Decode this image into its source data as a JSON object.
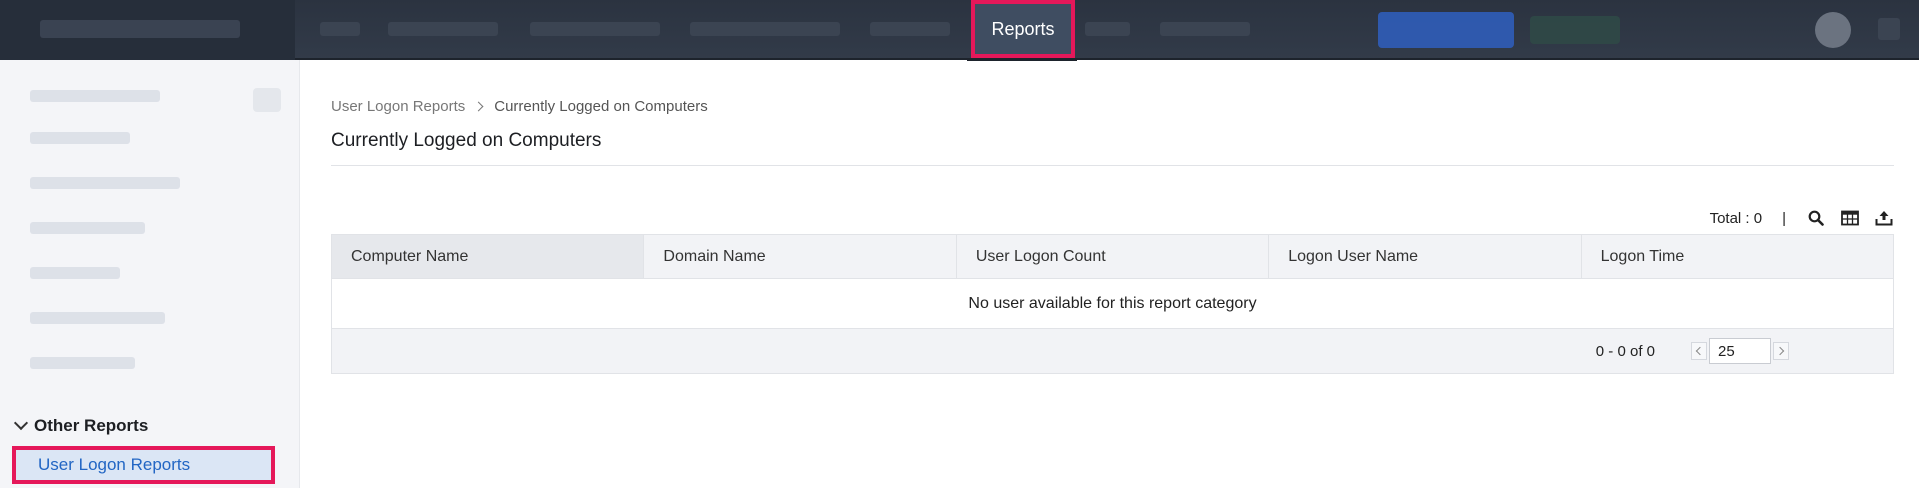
{
  "header": {
    "active_tab": "Reports"
  },
  "sidebar": {
    "section": {
      "label": "Other Reports"
    },
    "selected_item": {
      "label": "User Logon Reports"
    }
  },
  "breadcrumb": {
    "parent": "User Logon Reports",
    "current": "Currently Logged on Computers"
  },
  "page": {
    "title": "Currently Logged on Computers"
  },
  "toolbar": {
    "total_label": "Total : 0",
    "separator": "|",
    "icons": [
      "search-icon",
      "table-columns-icon",
      "export-icon"
    ]
  },
  "table": {
    "columns": [
      "Computer Name",
      "Domain Name",
      "User Logon Count",
      "Logon User Name",
      "Logon Time"
    ],
    "empty_message": "No user available for this report category",
    "pagination": {
      "range": "0 - 0 of 0",
      "page_size": "25"
    }
  },
  "colors": {
    "highlight_border": "#e5185a",
    "topbar_bg": "#2b3340",
    "link_blue": "#2266c4"
  }
}
